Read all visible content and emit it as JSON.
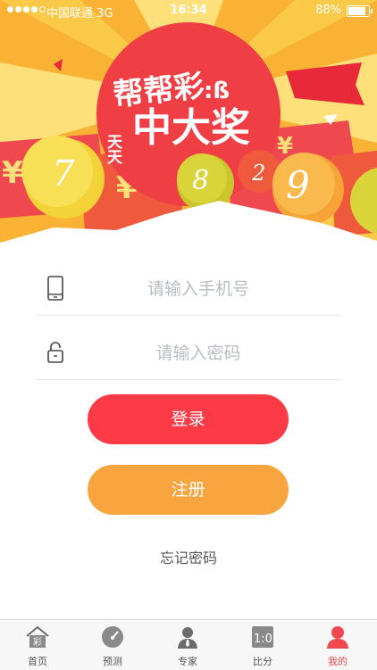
{
  "status_bar": {
    "carrier": "中国联通  3G",
    "time": "16:34",
    "battery": "88%",
    "battery_level": 0.88
  },
  "banner": {
    "logo_title": "帮帮彩",
    "logo_subtitle_small": "天天",
    "logo_subtitle": "中大奖",
    "balls": [
      "7",
      "8",
      "2",
      "9"
    ],
    "coin_symbol": "¥"
  },
  "login_form": {
    "phone_placeholder": "请输入手机号",
    "password_placeholder": "请输入密码",
    "login_label": "登录",
    "register_label": "注册",
    "forgot_label": "忘记密码"
  },
  "tab_bar": {
    "items": [
      {
        "label": "首页",
        "icon": "home-icon",
        "glyph": "彩"
      },
      {
        "label": "预测",
        "icon": "gauge-icon"
      },
      {
        "label": "专家",
        "icon": "expert-icon"
      },
      {
        "label": "比分",
        "icon": "scoreboard-icon",
        "glyph": "1:0"
      },
      {
        "label": "我的",
        "icon": "profile-icon"
      }
    ],
    "active_index": 4
  },
  "colors": {
    "login_button": "#fc3b47",
    "register_button": "#f9a53f",
    "active_tab": "#f0484f"
  }
}
